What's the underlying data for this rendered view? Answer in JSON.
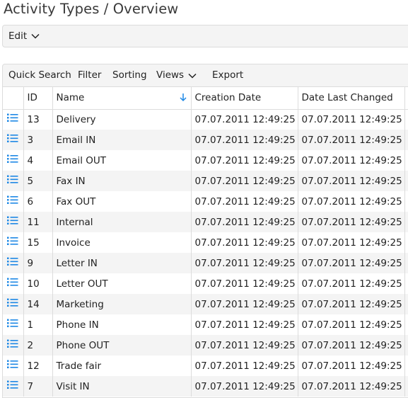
{
  "page": {
    "title": "Activity Types / Overview"
  },
  "edit_bar": {
    "edit_label": "Edit"
  },
  "toolbar": {
    "quick_search": "Quick Search",
    "filter": "Filter",
    "sorting": "Sorting",
    "views": "Views",
    "export": "Export"
  },
  "table": {
    "columns": [
      "ID",
      "Name",
      "Creation Date",
      "Date Last Changed"
    ],
    "sort": {
      "column": "Name",
      "direction": "ascending"
    },
    "rows": [
      {
        "id": "13",
        "name": "Delivery",
        "created": "07.07.2011 12:49:25",
        "changed": "07.07.2011 12:49:25"
      },
      {
        "id": "3",
        "name": "Email IN",
        "created": "07.07.2011 12:49:25",
        "changed": "07.07.2011 12:49:25"
      },
      {
        "id": "4",
        "name": "Email OUT",
        "created": "07.07.2011 12:49:25",
        "changed": "07.07.2011 12:49:25"
      },
      {
        "id": "5",
        "name": "Fax IN",
        "created": "07.07.2011 12:49:25",
        "changed": "07.07.2011 12:49:25"
      },
      {
        "id": "6",
        "name": "Fax OUT",
        "created": "07.07.2011 12:49:25",
        "changed": "07.07.2011 12:49:25"
      },
      {
        "id": "11",
        "name": "Internal",
        "created": "07.07.2011 12:49:25",
        "changed": "07.07.2011 12:49:25"
      },
      {
        "id": "15",
        "name": "Invoice",
        "created": "07.07.2011 12:49:25",
        "changed": "07.07.2011 12:49:25"
      },
      {
        "id": "9",
        "name": "Letter IN",
        "created": "07.07.2011 12:49:25",
        "changed": "07.07.2011 12:49:25"
      },
      {
        "id": "10",
        "name": "Letter OUT",
        "created": "07.07.2011 12:49:25",
        "changed": "07.07.2011 12:49:25"
      },
      {
        "id": "14",
        "name": "Marketing",
        "created": "07.07.2011 12:49:25",
        "changed": "07.07.2011 12:49:25"
      },
      {
        "id": "1",
        "name": "Phone IN",
        "created": "07.07.2011 12:49:25",
        "changed": "07.07.2011 12:49:25"
      },
      {
        "id": "2",
        "name": "Phone OUT",
        "created": "07.07.2011 12:49:25",
        "changed": "07.07.2011 12:49:25"
      },
      {
        "id": "12",
        "name": "Trade fair",
        "created": "07.07.2011 12:49:25",
        "changed": "07.07.2011 12:49:25"
      },
      {
        "id": "7",
        "name": "Visit IN",
        "created": "07.07.2011 12:49:25",
        "changed": "07.07.2011 12:49:25"
      }
    ]
  },
  "icons": {
    "row_icon": "list-details-icon",
    "sort_icon": "arrow-down-icon",
    "chevron": "chevron-down-icon"
  },
  "colors": {
    "accent": "#1e88e5",
    "toolbar_bg": "#f4f4f4",
    "alt_row_bg": "#f4f4f4",
    "border": "#dcdcdc"
  }
}
